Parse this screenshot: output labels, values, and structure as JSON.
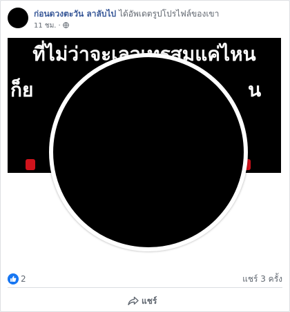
{
  "post": {
    "author": "ก่อนดวงตะวัน ลาลับไป",
    "action": "ได้อัพเดตรูปโปรไฟล์ของเขา",
    "time": "11 ชม.",
    "separator": "·",
    "privacy_icon": "globe-icon"
  },
  "photo": {
    "cover_text_line1": "ที่ไม่ว่าจะเลวเทรสมแค่ไหน",
    "cover_text_line2": "ก็ย",
    "cover_text_line2b": "น"
  },
  "reactions": {
    "like_icon": "thumbs-up-icon",
    "like_count": "2",
    "shares": "แชร์ 3 ครั้ง"
  },
  "actions": {
    "share_label": "แชร์",
    "share_icon": "share-arrow-icon"
  },
  "colors": {
    "name_link": "#385898",
    "like_blue": "#1877f2",
    "text_muted": "#606770"
  }
}
